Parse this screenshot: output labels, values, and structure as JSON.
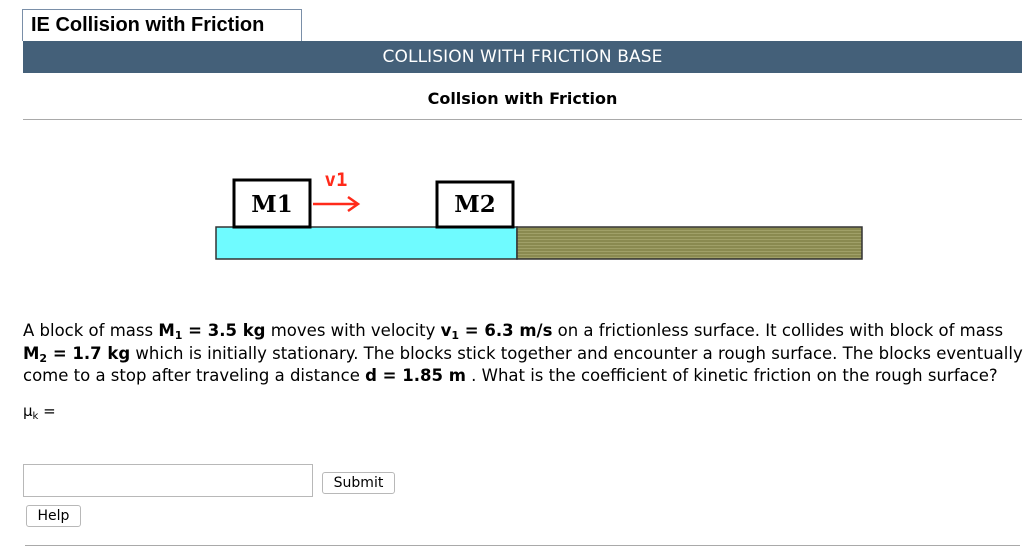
{
  "window": {
    "title": "IE Collision with Friction"
  },
  "banner": {
    "title": "COLLISION WITH FRICTION BASE"
  },
  "subtitle": "Collsion with Friction",
  "diagram": {
    "block1_label": "M1",
    "block2_label": "M2",
    "velocity_label": "v1",
    "colors": {
      "frictionless": "#6ffbff",
      "rough": "#8a8a50",
      "arrow": "#ff2a1a"
    }
  },
  "problem": {
    "p1": "A block of mass ",
    "m1_sym": "M",
    "m1_sub": "1",
    "m1_val": " = 3.5 kg",
    "p2": " moves with velocity ",
    "v1_sym": "v",
    "v1_sub": "1",
    "v1_val": " = 6.3 m/s",
    "p3": " on a frictionless surface. It collides with block of mass ",
    "m2_sym": "M",
    "m2_sub": "2",
    "m2_val": " = 1.7 kg",
    "p4": " which is initially stationary. The blocks stick together and encounter a rough surface. The blocks eventually come to a stop after traveling a distance ",
    "d_val": "d = 1.85 m",
    "p5": " . What is the coefficient of kinetic friction on the rough surface?"
  },
  "answer": {
    "mu_symbol": "μ",
    "mu_sub": "k",
    "mu_eq": " =",
    "input_value": "",
    "submit_label": "Submit",
    "help_label": "Help"
  }
}
